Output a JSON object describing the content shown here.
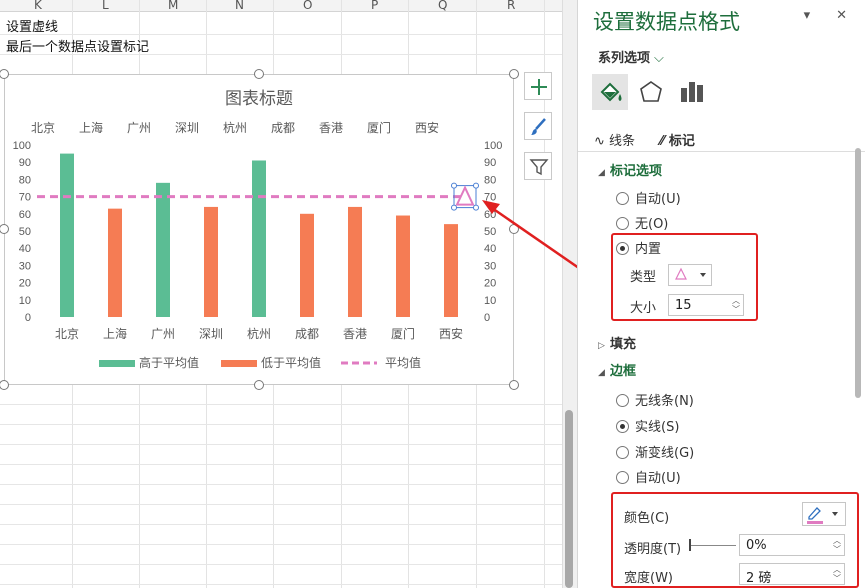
{
  "sheet": {
    "columns": [
      "K",
      "L",
      "M",
      "N",
      "O",
      "P",
      "Q",
      "R"
    ],
    "cell_line1": "设置虚线",
    "cell_line2": "最后一个数据点设置标记"
  },
  "chart": {
    "title": "图表标题",
    "legend": {
      "above": "高于平均值",
      "below": "低于平均值",
      "avg": "平均值"
    }
  },
  "chart_data": {
    "type": "bar",
    "categories": [
      "北京",
      "上海",
      "广州",
      "深圳",
      "杭州",
      "成都",
      "香港",
      "厦门",
      "西安"
    ],
    "series": [
      {
        "name": "高于平均值",
        "values": [
          95,
          null,
          78,
          null,
          91,
          null,
          null,
          null,
          null
        ],
        "color": "#5bbd94"
      },
      {
        "name": "低于平均值",
        "values": [
          null,
          63,
          null,
          64,
          null,
          60,
          64,
          59,
          54
        ],
        "color": "#f57c54"
      },
      {
        "name": "平均值",
        "values": [
          70,
          70,
          70,
          70,
          70,
          70,
          70,
          70,
          70
        ],
        "color": "#e07bc1",
        "style": "dashed-line",
        "marker_last": "triangle"
      }
    ],
    "ylim": [
      0,
      100
    ],
    "yticks": [
      0,
      10,
      20,
      30,
      40,
      50,
      60,
      70,
      80,
      90,
      100
    ],
    "grid": false,
    "legend_position": "bottom"
  },
  "pane": {
    "title": "设置数据点格式",
    "series_options": "系列选项",
    "tab_line": "线条",
    "tab_marker": "标记",
    "marker_options": "标记选项",
    "opt_auto": "自动(U)",
    "opt_none": "无(O)",
    "opt_builtin": "内置",
    "type_label": "类型",
    "size_label": "大小",
    "size_value": "15",
    "fill": "填充",
    "border": "边框",
    "b_none": "无线条(N)",
    "b_solid": "实线(S)",
    "b_gradient": "渐变线(G)",
    "b_auto": "自动(U)",
    "color_label": "颜色(C)",
    "transparency_label": "透明度(T)",
    "transparency_value": "0%",
    "width_label": "宽度(W)",
    "width_value": "2 磅",
    "accent": "#1e6e3c",
    "highlight": "#e02020"
  }
}
